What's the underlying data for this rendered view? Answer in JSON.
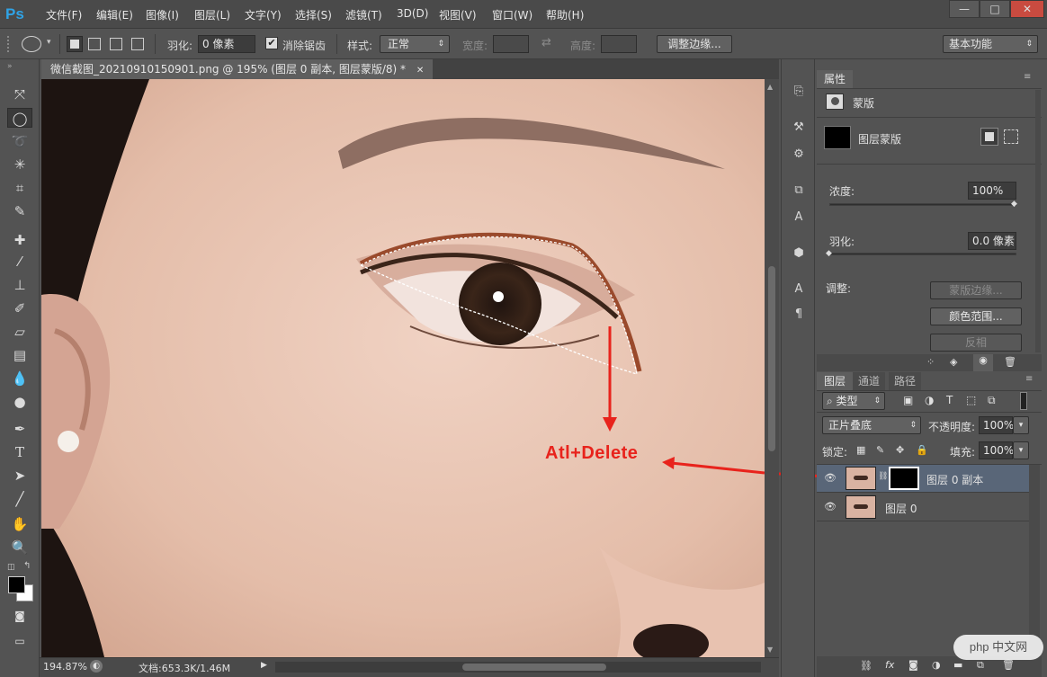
{
  "app": {
    "logo": "Ps"
  },
  "menu": [
    "文件(F)",
    "编辑(E)",
    "图像(I)",
    "图层(L)",
    "文字(Y)",
    "选择(S)",
    "滤镜(T)",
    "3D(D)",
    "视图(V)",
    "窗口(W)",
    "帮助(H)"
  ],
  "window_controls": {
    "minimize": "—",
    "maximize": "□",
    "close": "✕"
  },
  "options": {
    "feather_label": "羽化:",
    "feather_value": "0 像素",
    "antialias_label": "消除锯齿",
    "style_label": "样式:",
    "style_value": "正常",
    "width_label": "宽度:",
    "height_label": "高度:",
    "refine_edge_button": "调整边缘...",
    "workspace": "基本功能"
  },
  "document": {
    "tab_title": "微信截图_20210910150901.png @ 195% (图层 0 副本, 图层蒙版/8) *",
    "zoom": "194.87%",
    "doc_info": "文档:653.3K/1.46M"
  },
  "annotation": {
    "label": "Atl+Delete",
    "color": "#e8231c"
  },
  "properties": {
    "tab": "属性",
    "mask_title": "蒙版",
    "layer_mask": "图层蒙版",
    "density_label": "浓度:",
    "density_value": "100%",
    "feather_label": "羽化:",
    "feather_value": "0.0 像素",
    "adjust_label": "调整:",
    "mask_edge_button": "蒙版边缘...",
    "color_range_button": "颜色范围...",
    "invert_button": "反相"
  },
  "layers": {
    "tabs": [
      "图层",
      "通道",
      "路径"
    ],
    "filter_kind": "类型",
    "blend_mode": "正片叠底",
    "opacity_label": "不透明度:",
    "opacity_value": "100%",
    "lock_label": "锁定:",
    "fill_label": "填充:",
    "fill_value": "100%",
    "items": [
      {
        "name": "图层 0 副本",
        "selected": true,
        "has_mask": true
      },
      {
        "name": "图层 0",
        "selected": false,
        "has_mask": false
      }
    ]
  },
  "watermark": "php 中文网",
  "colors": {
    "accent": "#2fa3e6",
    "panel_bg": "#535353",
    "selected_row": "#596678",
    "arrow": "#e8231c"
  }
}
